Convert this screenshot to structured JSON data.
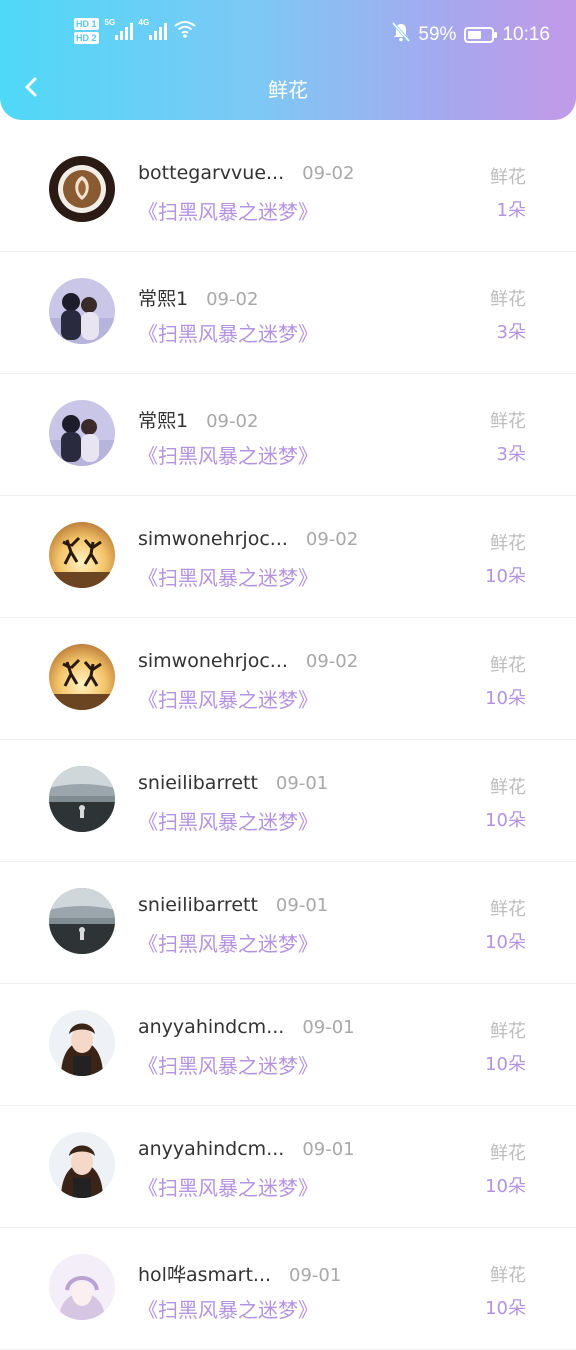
{
  "status_bar": {
    "hd1": "HD 1",
    "hd2": "HD 2",
    "net1": "5G",
    "net2": "4G",
    "battery_percent": "59%",
    "battery_level": 0.59,
    "time": "10:16",
    "icons": [
      "signal-icon",
      "wifi-icon",
      "mute-bell-icon",
      "battery-icon"
    ]
  },
  "nav": {
    "title": "鲜花",
    "back_icon": "chevron-left-icon"
  },
  "colors": {
    "header_gradient_start": "#4fd8f7",
    "header_gradient_end": "#c29ae9",
    "accent_purple": "#b493e0",
    "muted_gray": "#a8a8a8"
  },
  "records": [
    {
      "name": "bottegarvvue...",
      "date": "09-02",
      "movie": "《扫黑风暴之迷梦》",
      "label": "鲜花",
      "count": "1朵",
      "avatar": "coffee"
    },
    {
      "name": "常熙1",
      "date": "09-02",
      "movie": "《扫黑风暴之迷梦》",
      "label": "鲜花",
      "count": "3朵",
      "avatar": "couple"
    },
    {
      "name": "常熙1",
      "date": "09-02",
      "movie": "《扫黑风暴之迷梦》",
      "label": "鲜花",
      "count": "3朵",
      "avatar": "couple"
    },
    {
      "name": "simwonehrjoc...",
      "date": "09-02",
      "movie": "《扫黑风暴之迷梦》",
      "label": "鲜花",
      "count": "10朵",
      "avatar": "sunset"
    },
    {
      "name": "simwonehrjoc...",
      "date": "09-02",
      "movie": "《扫黑风暴之迷梦》",
      "label": "鲜花",
      "count": "10朵",
      "avatar": "sunset"
    },
    {
      "name": "snieilibarrett",
      "date": "09-01",
      "movie": "《扫黑风暴之迷梦》",
      "label": "鲜花",
      "count": "10朵",
      "avatar": "beach"
    },
    {
      "name": "snieilibarrett",
      "date": "09-01",
      "movie": "《扫黑风暴之迷梦》",
      "label": "鲜花",
      "count": "10朵",
      "avatar": "beach"
    },
    {
      "name": "anyyahindcm...",
      "date": "09-01",
      "movie": "《扫黑风暴之迷梦》",
      "label": "鲜花",
      "count": "10朵",
      "avatar": "girl"
    },
    {
      "name": "anyyahindcm...",
      "date": "09-01",
      "movie": "《扫黑风暴之迷梦》",
      "label": "鲜花",
      "count": "10朵",
      "avatar": "girl"
    },
    {
      "name": "hol哗asmart...",
      "date": "09-01",
      "movie": "《扫黑风暴之迷梦》",
      "label": "鲜花",
      "count": "10朵",
      "avatar": "anime"
    }
  ]
}
